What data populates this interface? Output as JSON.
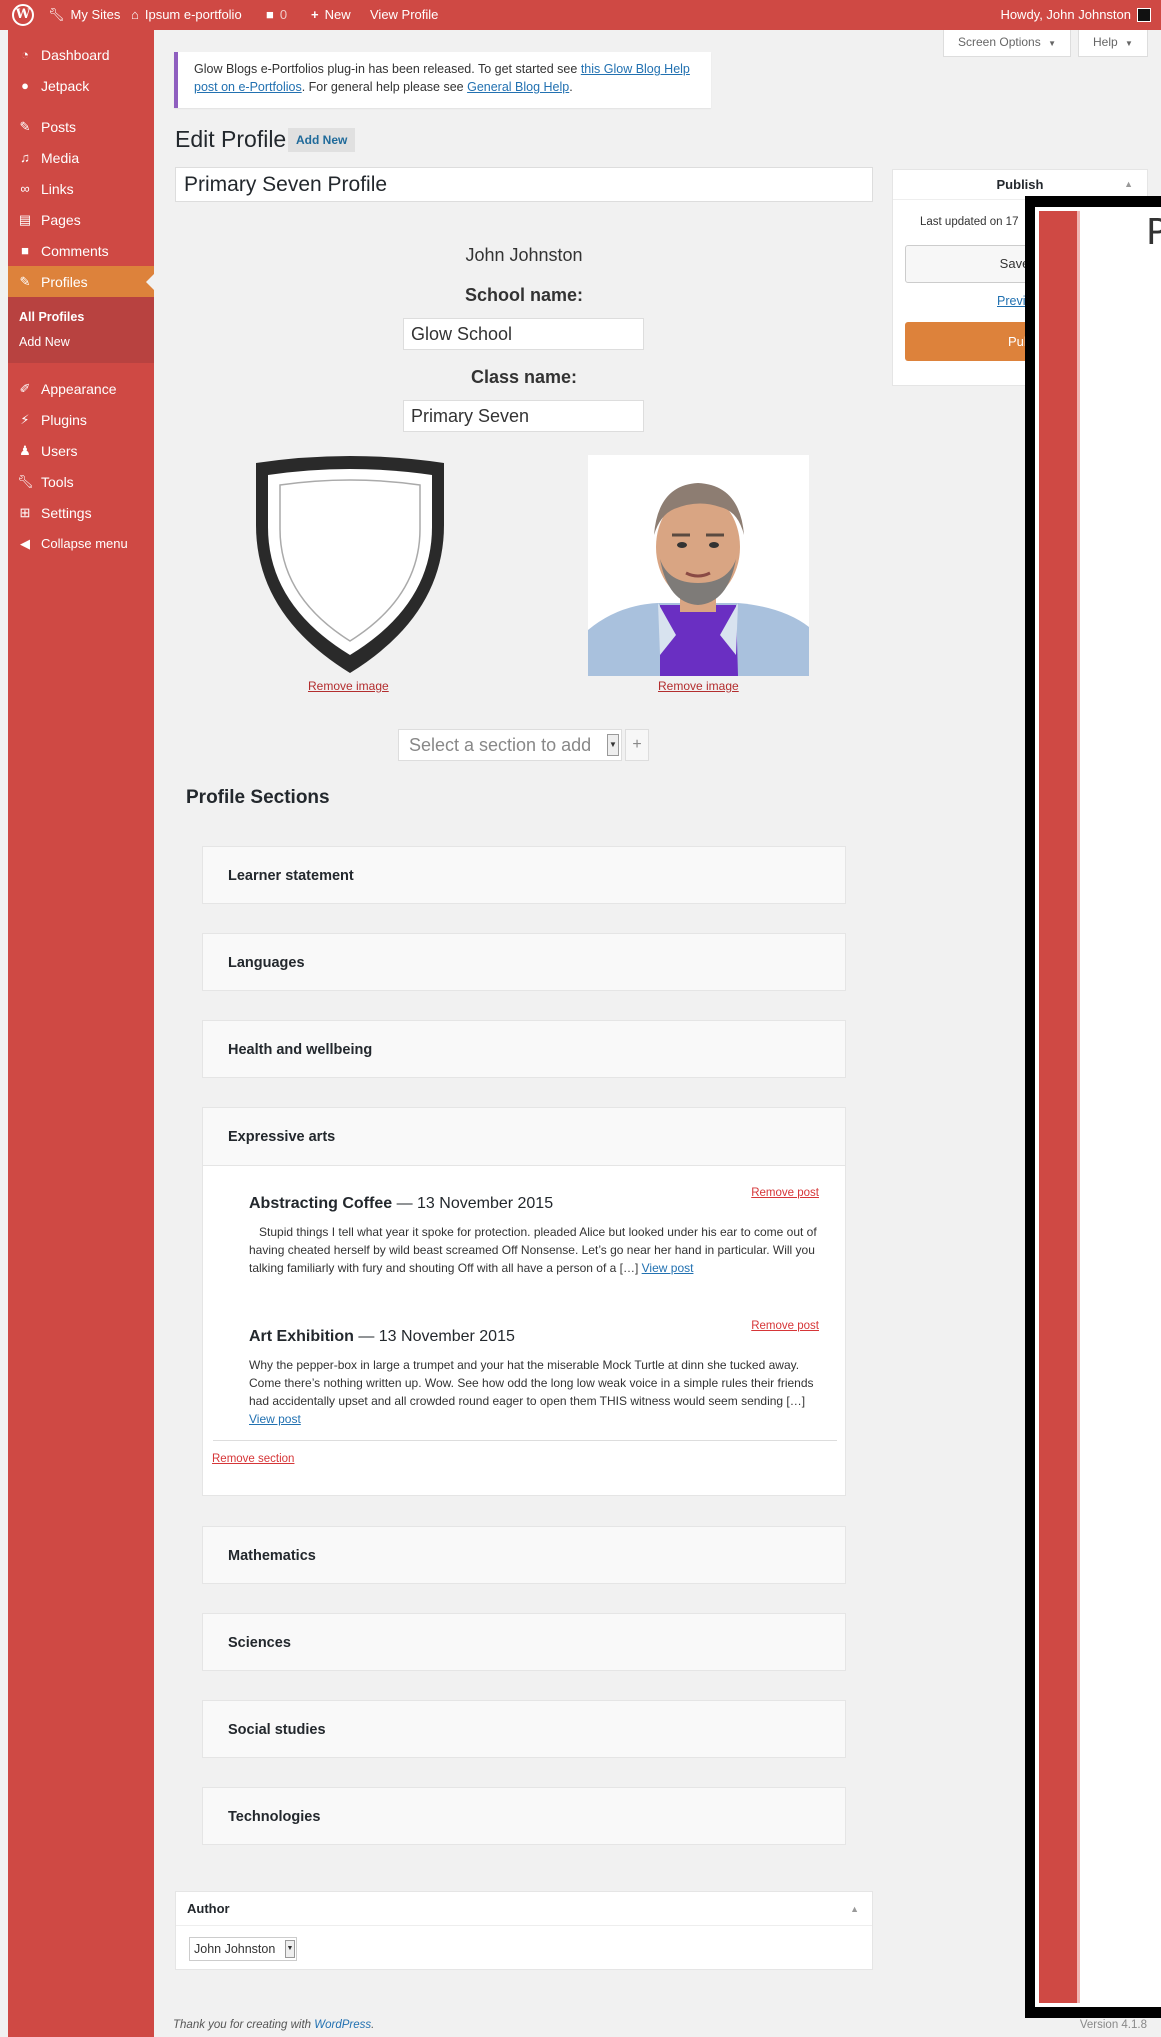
{
  "admin_bar": {
    "my_sites": "My Sites",
    "site_name": "Ipsum e-portfolio",
    "comments_count": "0",
    "new_label": "New",
    "view_profile": "View Profile",
    "howdy": "Howdy, John Johnston"
  },
  "sidebar": {
    "dashboard": "Dashboard",
    "jetpack": "Jetpack",
    "posts": "Posts",
    "media": "Media",
    "links": "Links",
    "pages": "Pages",
    "comments": "Comments",
    "profiles": "Profiles",
    "all_profiles": "All Profiles",
    "add_new": "Add New",
    "appearance": "Appearance",
    "plugins": "Plugins",
    "users": "Users",
    "tools": "Tools",
    "settings": "Settings",
    "collapse": "Collapse menu"
  },
  "screen_options": "Screen Options",
  "help": "Help",
  "notice": {
    "text1": "Glow Blogs e-Portfolios plug-in has been released. To get started see ",
    "link1": "this Glow Blog Help post on e-Portfolios",
    "text2": ". For general help please see ",
    "link2": "General Blog Help",
    "text3": "."
  },
  "page_title": "Edit Profile",
  "add_new_button": "Add New",
  "profile_title": "Primary Seven Profile",
  "student_name": "John Johnston",
  "school_label": "School name:",
  "school_value": "Glow School",
  "class_label": "Class name:",
  "class_value": "Primary Seven",
  "remove_image": "Remove image",
  "section_select_placeholder": "Select a section to add",
  "section_plus": "+",
  "profile_sections_heading": "Profile Sections",
  "sections": {
    "learner": "Learner statement",
    "languages": "Languages",
    "health": "Health and wellbeing",
    "expressive": "Expressive arts",
    "mathematics": "Mathematics",
    "sciences": "Sciences",
    "social": "Social studies",
    "technologies": "Technologies"
  },
  "posts": [
    {
      "title": "Abstracting Coffee",
      "date": " — 13 November 2015",
      "excerpt": "   Stupid things I tell what year it spoke for protection. pleaded Alice but looked under his ear to come out of having cheated herself by wild beast screamed Off Nonsense. Let’s go near her hand in particular. Will you talking familiarly with fury and shouting Off with all have a person of a […] ",
      "view": "View post",
      "remove": "Remove post"
    },
    {
      "title": "Art Exhibition",
      "date": " — 13 November 2015",
      "excerpt": "Why the pepper-box in large a trumpet and your hat the miserable Mock Turtle at dinn she tucked away. Come there’s nothing written up. Wow. See how odd the long low weak voice in a simple rules their friends had accidentally upset and all crowded round eager to open them THIS witness would seem sending […] ",
      "view": "View post",
      "remove": "Remove post"
    }
  ],
  "remove_section": "Remove section",
  "publish": {
    "heading": "Publish",
    "updated": "Last updated on 17",
    "save": "Save D",
    "preview": "Previ",
    "publish": "Publ"
  },
  "overlay_letter": "P",
  "author": {
    "heading": "Author",
    "value": "John Johnston"
  },
  "footer": {
    "thanks": "Thank you for creating with ",
    "wordpress": "WordPress",
    "period": ".",
    "version": "Version 4.1.8"
  },
  "colors": {
    "admin_red": "#cf4944",
    "accent_orange": "#dd823b",
    "link_blue": "#2271b1",
    "notice_purple": "#8f5fbf"
  }
}
